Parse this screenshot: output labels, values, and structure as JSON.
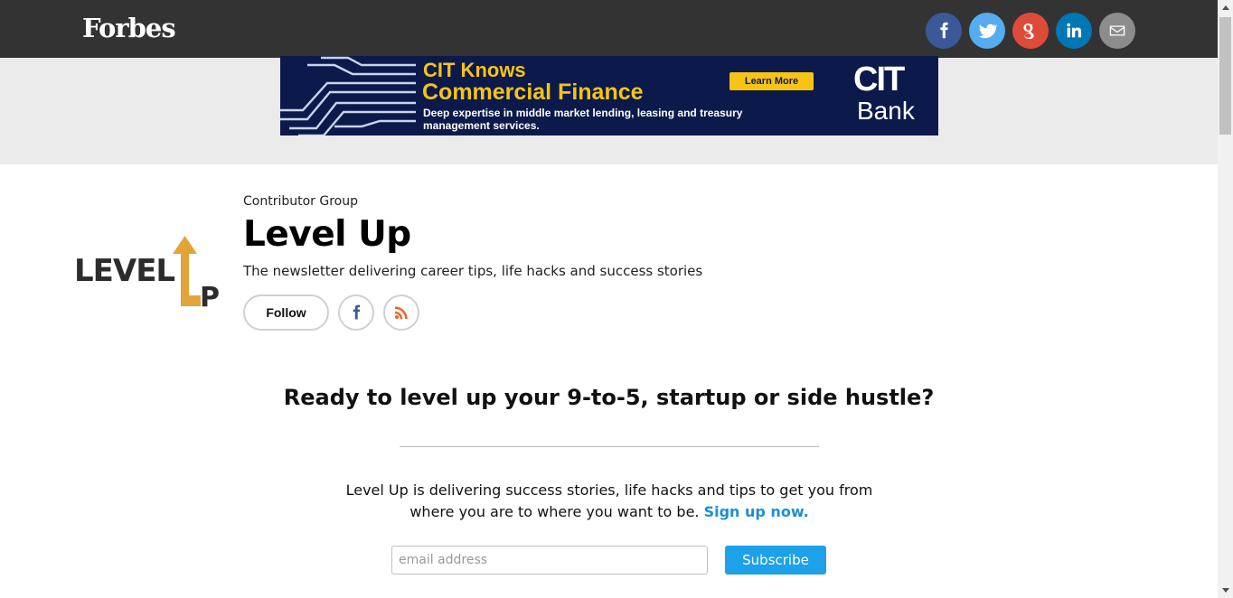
{
  "header": {
    "logo": "Forbes",
    "share": [
      {
        "name": "facebook",
        "icon": "facebook-icon",
        "color": "#3b5998"
      },
      {
        "name": "twitter",
        "icon": "twitter-icon",
        "color": "#55acee"
      },
      {
        "name": "google-plus",
        "icon": "google-plus-icon",
        "color": "#dd4b39"
      },
      {
        "name": "linkedin",
        "icon": "linkedin-icon",
        "color": "#0077b5"
      },
      {
        "name": "email",
        "icon": "email-icon",
        "color": "#8c8c8c"
      }
    ]
  },
  "ad": {
    "headline_line1": "CIT Knows",
    "headline_line2": "Commercial Finance",
    "body": "Deep expertise in middle market lending, leasing and treasury management services.",
    "cta": "Learn More",
    "brand_line1": "CIT",
    "brand_line2": "Bank",
    "colors": {
      "background": "#0b1a4a",
      "accent": "#f7c416"
    }
  },
  "contributor": {
    "group_label": "Contributor Group",
    "title": "Level Up",
    "tagline": "The newsletter delivering career tips, life hacks and success stories",
    "follow_label": "Follow",
    "avatar_text_top": "LEVEL",
    "avatar_text_bottom": "P"
  },
  "newsletter": {
    "heading": "Ready to level up your 9-to-5, startup or side hustle?",
    "body": "Level Up is delivering success stories, life hacks and tips to get you from where you are to where you want to be.",
    "link_text": "Sign up now.",
    "email_placeholder": "email address",
    "subscribe_label": "Subscribe",
    "colors": {
      "link": "#1b8fd6",
      "button": "#1da1e8"
    }
  }
}
